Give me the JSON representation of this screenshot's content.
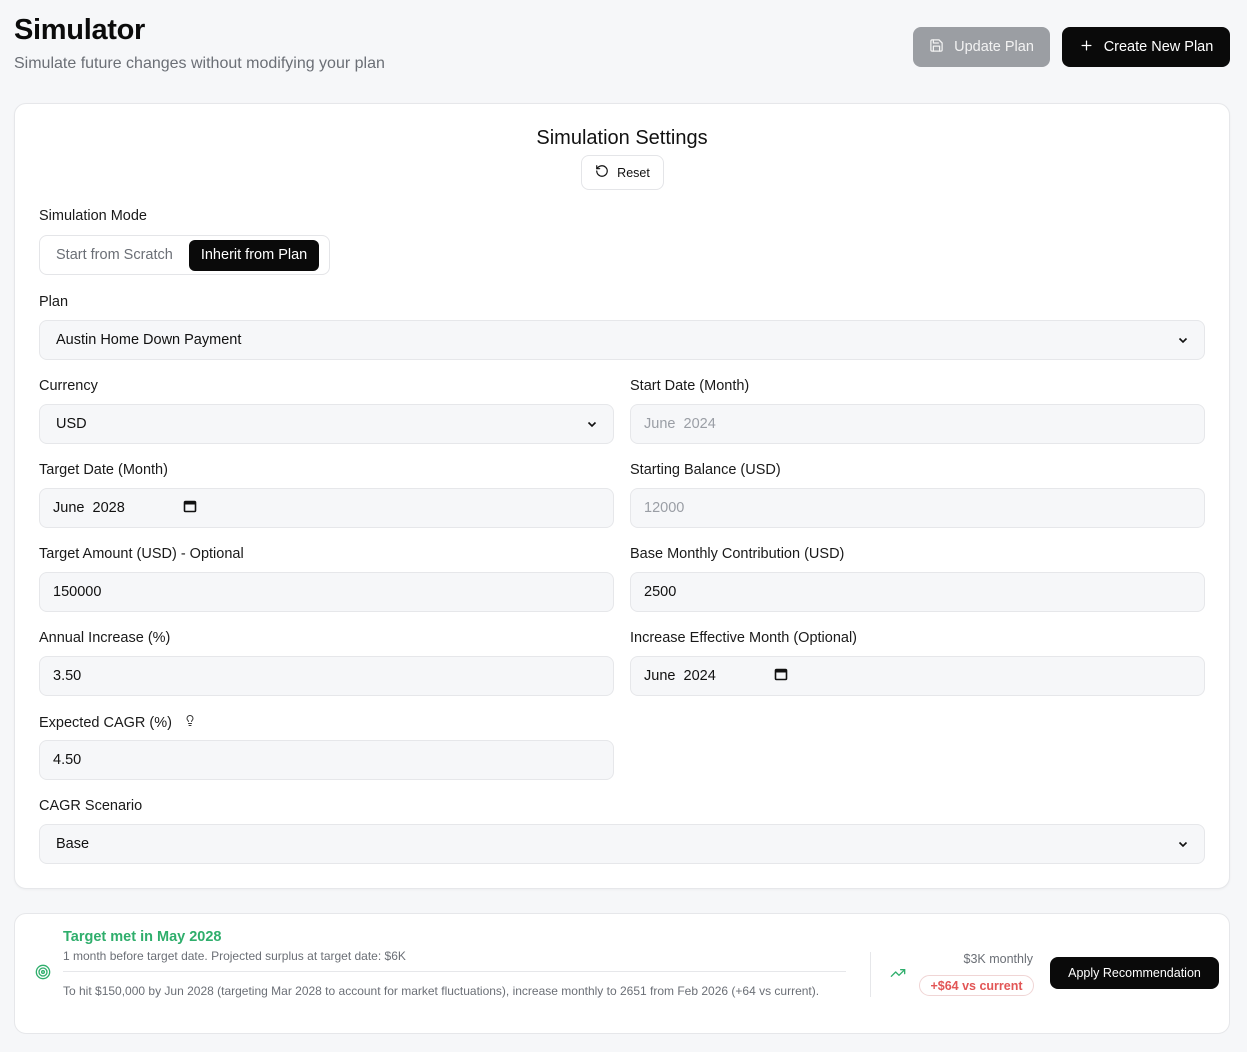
{
  "header": {
    "title": "Simulator",
    "subtitle": "Simulate future changes without modifying your plan",
    "update_label": "Update Plan",
    "create_label": "Create New Plan"
  },
  "settings": {
    "title": "Simulation Settings",
    "reset_label": "Reset",
    "mode_label": "Simulation Mode",
    "mode_options": [
      "Start from Scratch",
      "Inherit from Plan"
    ],
    "mode_selected": "Inherit from Plan",
    "plan_label": "Plan",
    "plan_value": "Austin Home Down Payment",
    "currency_label": "Currency",
    "currency_value": "USD",
    "start_date_label": "Start Date (Month)",
    "start_date_value": "June  2024",
    "target_date_label": "Target Date (Month)",
    "target_date_value": "June  2028",
    "starting_balance_label": "Starting Balance (USD)",
    "starting_balance_value": "12000",
    "target_amount_label": "Target Amount (USD) - Optional",
    "target_amount_value": "150000",
    "base_contribution_label": "Base Monthly Contribution (USD)",
    "base_contribution_value": "2500",
    "annual_increase_label": "Annual Increase (%)",
    "annual_increase_value": "3.50",
    "increase_month_label": "Increase Effective Month (Optional)",
    "increase_month_value": "June  2024",
    "cagr_label": "Expected CAGR (%)",
    "cagr_value": "4.50",
    "scenario_label": "CAGR Scenario",
    "scenario_value": "Base"
  },
  "recommendation": {
    "title": "Target met in May 2028",
    "subtitle": "1 month before target date. Projected surplus at target date: $6K",
    "description": "To hit $150,000 by Jun 2028 (targeting Mar 2028 to account for market fluctuations), increase monthly to 2651 from Feb 2026 (+64 vs current).",
    "monthly": "$3K monthly",
    "delta": "+$64 vs current",
    "apply_label": "Apply Recommendation"
  },
  "colors": {
    "accent_dark": "#0a0a0a",
    "success": "#2fae6c",
    "danger": "#e25656",
    "disabled_button": "#9b9ea3"
  },
  "icons": [
    "save-icon",
    "plus-icon",
    "reset-icon",
    "chevron-down-icon",
    "calendar-icon",
    "lightbulb-icon",
    "target-icon",
    "trending-up-icon"
  ]
}
